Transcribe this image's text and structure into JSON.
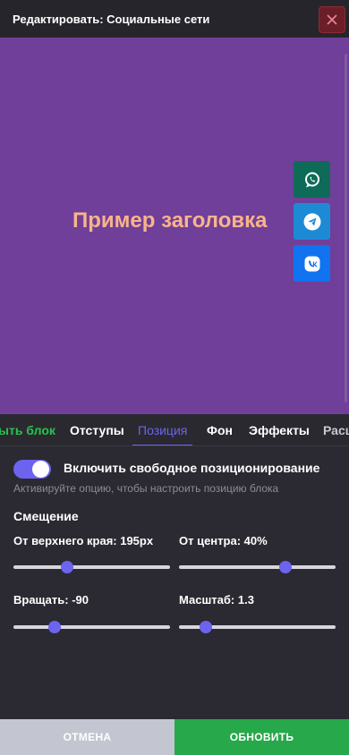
{
  "header": {
    "title": "Редактировать: Социальные сети",
    "close_icon": "close-icon"
  },
  "preview": {
    "title": "Пример заголовка",
    "social_buttons": [
      {
        "icon": "whatsapp-icon",
        "color": "#0e6b58"
      },
      {
        "icon": "telegram-icon",
        "color": "#1d8ad6"
      },
      {
        "icon": "vk-icon",
        "color": "#1173f0"
      }
    ]
  },
  "tabs": [
    {
      "label": "ыть блок",
      "color": "#27c24c"
    },
    {
      "label": "Отступы"
    },
    {
      "label": "Позиция",
      "active": true
    },
    {
      "label": "Фон"
    },
    {
      "label": "Эффекты"
    },
    {
      "label": "Расш"
    }
  ],
  "position": {
    "toggle_label": "Включить свободное позиционирование",
    "toggle_on": true,
    "hint": "Активируйте опцию, чтобы настроить позицию блока",
    "section_title": "Смещение",
    "sliders": {
      "top": {
        "label": "От верхнего края: 195px",
        "value": 195,
        "fraction": 0.34
      },
      "center": {
        "label": "От центра: 40%",
        "value": 40,
        "fraction": 0.68
      },
      "rotate": {
        "label": "Вращать: -90",
        "value": -90,
        "fraction": 0.26
      },
      "scale": {
        "label": "Масштаб: 1.3",
        "value": 1.3,
        "fraction": 0.17
      }
    }
  },
  "footer": {
    "cancel_label": "ОТМЕНА",
    "update_label": "ОБНОВИТЬ"
  },
  "colors": {
    "accent": "#6c64ef",
    "preview_bg": "#6f3f99",
    "title": "#f9b48a",
    "update": "#27a84a",
    "cancel": "#c3c6d0"
  }
}
